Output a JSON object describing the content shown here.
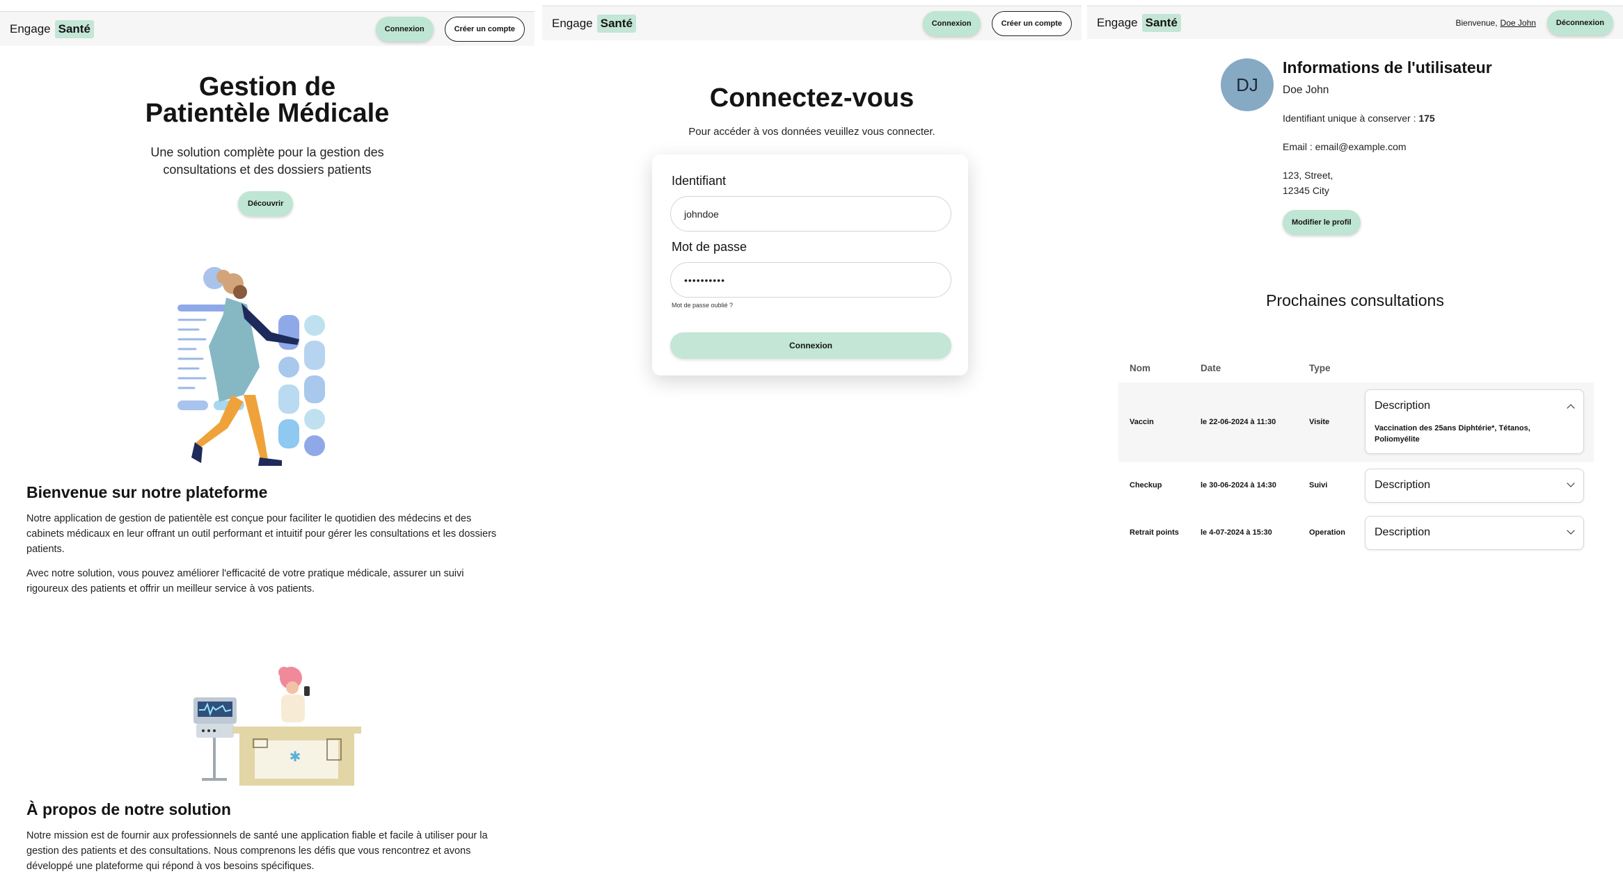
{
  "brand": {
    "part1": "Engage",
    "part2": "Santé"
  },
  "home": {
    "nav": {
      "login": "Connexion",
      "register": "Créer un compte"
    },
    "hero": {
      "title_line1": "Gestion de",
      "title_line2": "Patientèle Médicale",
      "subtitle_line1": "Une solution complète pour la gestion des",
      "subtitle_line2": "consultations et des dossiers patients",
      "cta": "Découvrir"
    },
    "welcome": {
      "title": "Bienvenue sur notre plateforme",
      "p1": "Notre application de gestion de patientèle est conçue pour faciliter le quotidien des médecins et des cabinets médicaux en leur offrant un outil performant et intuitif pour gérer les consultations et les dossiers patients.",
      "p2": "Avec notre solution, vous pouvez améliorer l'efficacité de votre pratique médicale, assurer un suivi rigoureux des patients et offrir un meilleur service à vos patients."
    },
    "about": {
      "title": "À propos de notre solution",
      "p1": "Notre mission est de fournir aux professionnels de santé une application fiable et facile à utiliser pour la gestion des patients et des consultations. Nous comprenons les défis que vous rencontrez et avons développé une plateforme qui répond à vos besoins spécifiques."
    }
  },
  "login": {
    "nav": {
      "login": "Connexion",
      "register": "Créer un compte"
    },
    "title": "Connectez-vous",
    "subtitle": "Pour accéder à vos données veuillez vous connecter.",
    "username_label": "Identifiant",
    "username_value": "johndoe",
    "password_label": "Mot de passe",
    "password_value": "••••••••••",
    "forgot": "Mot de passe oublié ?",
    "submit": "Connexion"
  },
  "profile": {
    "nav": {
      "greeting": "Bienvenue,",
      "user": "Doe John",
      "logout": "Déconnexion"
    },
    "avatar_initials": "DJ",
    "title": "Informations de l'utilisateur",
    "name": "Doe John",
    "id_label": "Identifiant unique à conserver :",
    "id_value": "175",
    "email": "Email : email@example.com",
    "address_line1": "123, Street,",
    "address_line2": "12345 City",
    "edit": "Modifier le profil",
    "consult_title": "Prochaines consultations",
    "columns": {
      "name": "Nom",
      "date": "Date",
      "type": "Type"
    },
    "rows": [
      {
        "name": "Vaccin",
        "date": "le 22-06-2024 à 11:30",
        "type": "Visite",
        "desc_label": "Description",
        "expanded": true,
        "desc_line1": "Vaccination des 25ans Diphtérie*, Tétanos,",
        "desc_line2": "Poliomyélite"
      },
      {
        "name": "Checkup",
        "date": "le 30-06-2024 à 14:30",
        "type": "Suivi",
        "desc_label": "Description",
        "expanded": false
      },
      {
        "name": "Retrait points",
        "date": "le 4-07-2024 à 15:30",
        "type": "Operation",
        "desc_label": "Description",
        "expanded": false
      }
    ]
  },
  "colors": {
    "accent": "#bfe5d4",
    "avatar": "#86a9c4",
    "navbar": "#f6f6f6"
  }
}
